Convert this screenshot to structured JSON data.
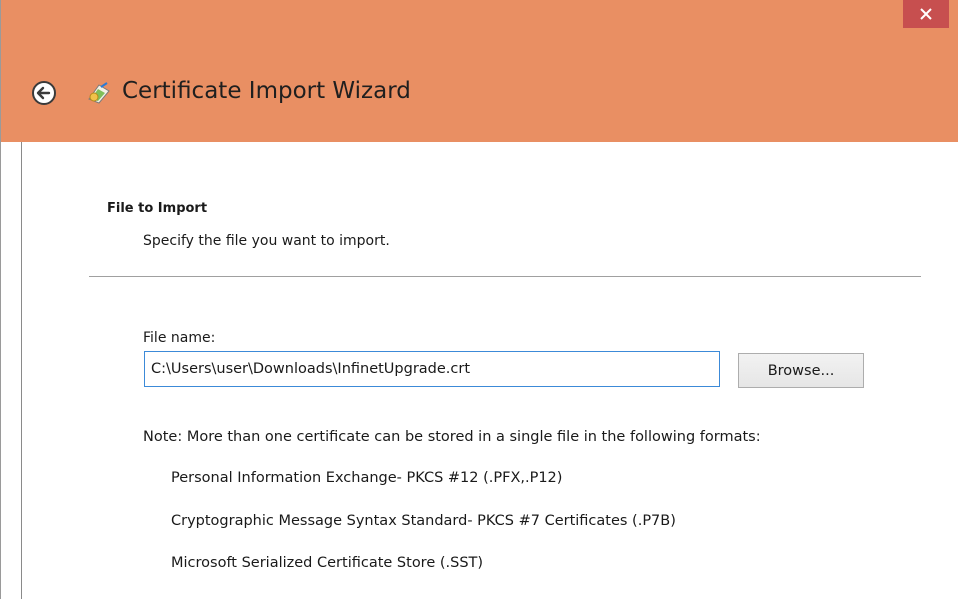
{
  "window": {
    "title": "Certificate Import Wizard",
    "close_glyph": "✕"
  },
  "page": {
    "heading": "File to Import",
    "subheading": "Specify the file you want to import."
  },
  "file_field": {
    "label": "File name:",
    "value": "C:\\Users\\user\\Downloads\\InfinetUpgrade.crt"
  },
  "buttons": {
    "browse": "Browse..."
  },
  "note": "Note:  More than one certificate can be stored in a single file in the following formats:",
  "formats": [
    "Personal Information Exchange- PKCS #12 (.PFX,.P12)",
    "Cryptographic Message Syntax Standard- PKCS #7 Certificates (.P7B)",
    "Microsoft Serialized Certificate Store (.SST)"
  ],
  "colors": {
    "titlebar": "#e98f63",
    "close_button": "#c74f4f",
    "input_border": "#3c8ad8"
  },
  "icons": {
    "back": "back-arrow-icon",
    "wizard": "certificate-icon",
    "close": "close-icon"
  }
}
